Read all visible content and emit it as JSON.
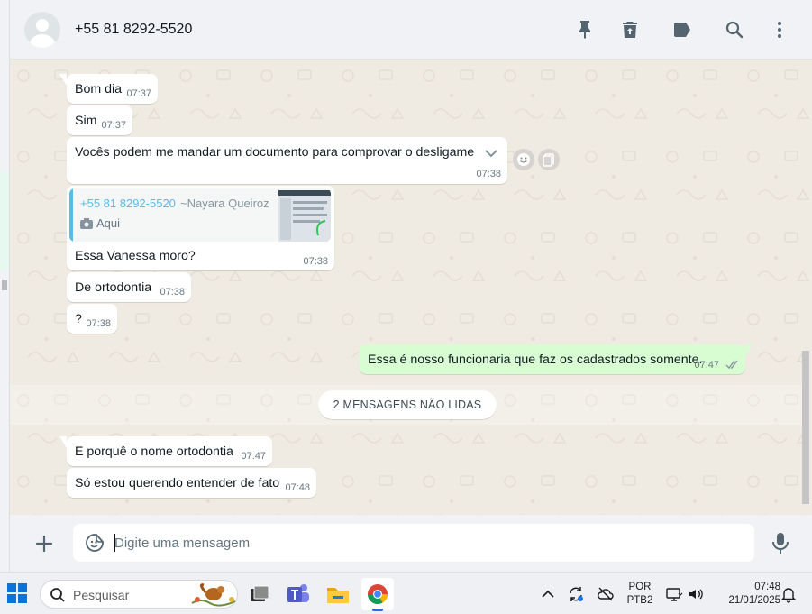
{
  "header": {
    "contact": "+55 81 8292-5520",
    "icons": [
      "pin-icon",
      "delete-icon",
      "label-icon",
      "search-icon",
      "menu-icon"
    ]
  },
  "messages": [
    {
      "dir": "in",
      "text": "Bom dia",
      "time": "07:37"
    },
    {
      "dir": "in",
      "text": "Sim",
      "time": "07:37"
    },
    {
      "dir": "in",
      "text": "Vocês podem me mandar um documento para comprovar o desligame",
      "time": "07:38"
    },
    {
      "dir": "in",
      "text": "Essa Vanessa moro?",
      "time": "07:38",
      "quote": {
        "author": "+55 81 8292-5520",
        "pushname": "~Nayara Queiroz",
        "text": "Aqui"
      }
    },
    {
      "dir": "in",
      "text": "De ortodontia",
      "time": "07:38"
    },
    {
      "dir": "in",
      "text": "?",
      "time": "07:38"
    },
    {
      "dir": "out",
      "text": "Essa é nosso funcionaria que faz os cadastrados somente.",
      "time": "07:47",
      "status": "read"
    },
    {
      "dir": "in",
      "text": "E porquê o nome ortodontia",
      "time": "07:47"
    },
    {
      "dir": "in",
      "text": "Só estou querendo entender de fato",
      "time": "07:48"
    }
  ],
  "unread_divider": "2 MENSAGENS NÃO LIDAS",
  "composer": {
    "placeholder": "Digite uma mensagem"
  },
  "colors": {
    "incoming": "#ffffff",
    "outgoing": "#d9fdd3",
    "wallpaper": "#efeae2",
    "quote_bar": "#53bdeb"
  },
  "taskbar": {
    "search_label": "Pesquisar",
    "lang_line1": "POR",
    "lang_line2": "PTB2",
    "time": "07:48",
    "date": "21/01/2025"
  }
}
